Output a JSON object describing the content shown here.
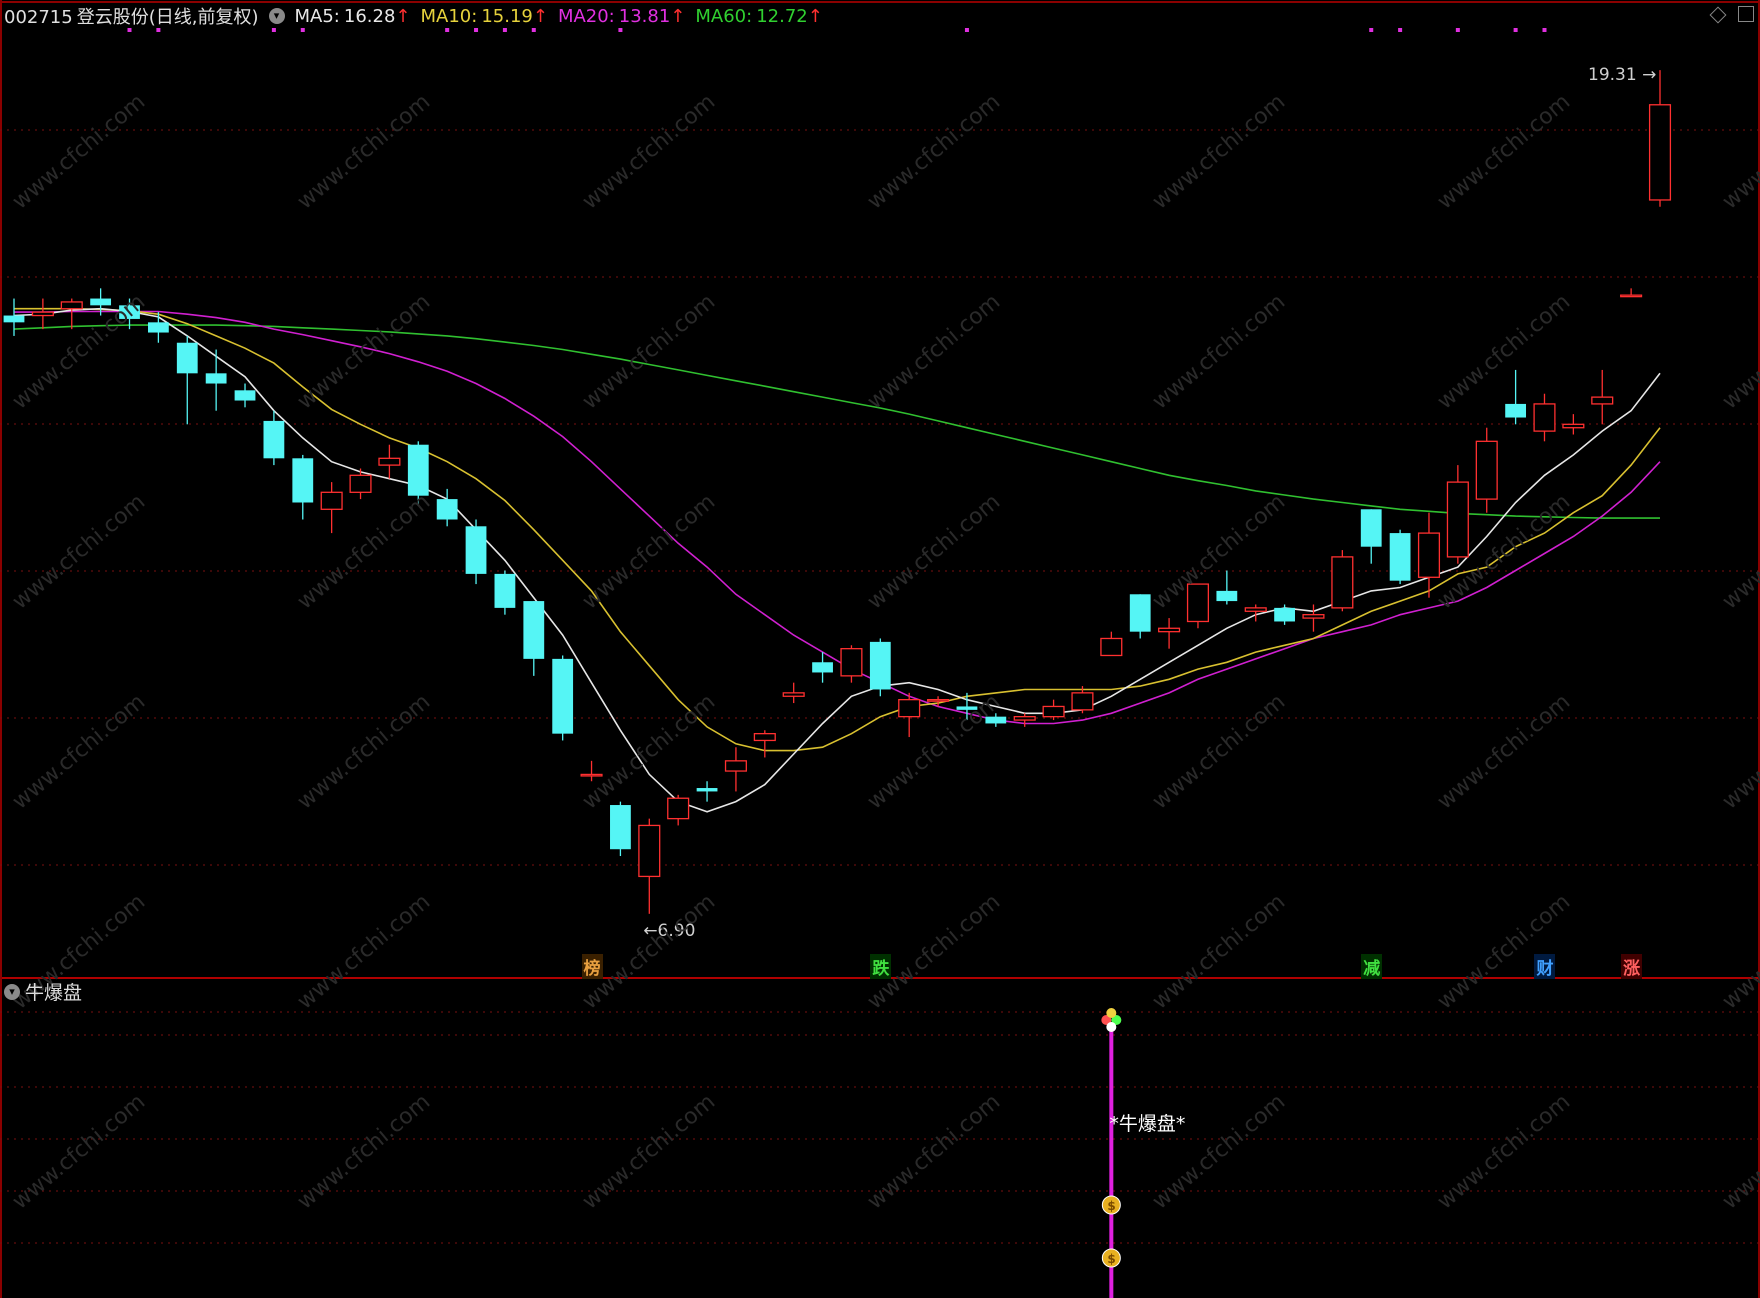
{
  "header": {
    "code": "002715",
    "name": "登云股份",
    "period": "(日线,前复权)",
    "ma5": {
      "label": "MA5:",
      "value": "16.28",
      "color": "#e8e8e8"
    },
    "ma10": {
      "label": "MA10:",
      "value": "15.19",
      "color": "#e6d23c"
    },
    "ma20": {
      "label": "MA20:",
      "value": "13.81",
      "color": "#e030e0"
    },
    "ma60": {
      "label": "MA60:",
      "value": "12.72",
      "color": "#30d030"
    },
    "arrow": "↑"
  },
  "annotations": {
    "high": "19.31",
    "low": "6.90",
    "high_arrow": "→",
    "low_arrow": "←"
  },
  "signals": [
    {
      "text": "榜",
      "color": "#e8a040",
      "bg": "#3a2000",
      "index": 20
    },
    {
      "text": "跌",
      "color": "#40e040",
      "bg": "#003000",
      "index": 30
    },
    {
      "text": "减",
      "color": "#40e040",
      "bg": "#003000",
      "index": 47
    },
    {
      "text": "财",
      "color": "#40a0ff",
      "bg": "#001a40",
      "index": 53
    },
    {
      "text": "涨",
      "color": "#ff6060",
      "bg": "#400000",
      "index": 56
    }
  ],
  "indicator": {
    "title": "牛爆盘",
    "label": "*牛爆盘*",
    "bar_index": 38
  },
  "chart_data": {
    "type": "candlestick",
    "ylim": [
      6.0,
      19.9
    ],
    "grid": "dotted-red",
    "ohlc": [
      [
        15.7,
        15.95,
        15.4,
        15.6
      ],
      [
        15.7,
        15.95,
        15.5,
        15.75
      ],
      [
        15.8,
        15.95,
        15.5,
        15.9
      ],
      [
        15.95,
        16.1,
        15.7,
        15.85
      ],
      [
        15.85,
        15.95,
        15.5,
        15.65
      ],
      [
        15.6,
        15.75,
        15.3,
        15.45
      ],
      [
        15.3,
        15.4,
        14.1,
        14.85
      ],
      [
        14.85,
        15.2,
        14.3,
        14.7
      ],
      [
        14.6,
        14.7,
        14.35,
        14.45
      ],
      [
        14.15,
        14.3,
        13.5,
        13.6
      ],
      [
        13.6,
        13.65,
        12.7,
        12.95
      ],
      [
        12.85,
        13.25,
        12.5,
        13.1
      ],
      [
        13.1,
        13.45,
        13.0,
        13.35
      ],
      [
        13.5,
        13.8,
        13.3,
        13.6
      ],
      [
        13.8,
        13.85,
        12.9,
        13.05
      ],
      [
        13.0,
        13.15,
        12.6,
        12.7
      ],
      [
        12.6,
        12.7,
        11.75,
        11.9
      ],
      [
        11.9,
        11.95,
        11.3,
        11.4
      ],
      [
        11.5,
        11.5,
        10.4,
        10.65
      ],
      [
        10.65,
        10.7,
        9.45,
        9.55
      ],
      [
        8.95,
        9.15,
        8.85,
        8.95
      ],
      [
        8.5,
        8.55,
        7.75,
        7.85
      ],
      [
        7.45,
        8.3,
        6.9,
        8.2
      ],
      [
        8.3,
        8.65,
        8.2,
        8.6
      ],
      [
        8.75,
        8.85,
        8.55,
        8.7
      ],
      [
        9.0,
        9.35,
        8.7,
        9.15
      ],
      [
        9.45,
        9.6,
        9.2,
        9.55
      ],
      [
        10.1,
        10.3,
        10.0,
        10.15
      ],
      [
        10.6,
        10.75,
        10.3,
        10.45
      ],
      [
        10.4,
        10.85,
        10.3,
        10.8
      ],
      [
        10.9,
        10.95,
        10.1,
        10.2
      ],
      [
        9.8,
        10.15,
        9.5,
        10.05
      ],
      [
        10.05,
        10.1,
        9.95,
        10.05
      ],
      [
        9.95,
        10.15,
        9.75,
        9.9
      ],
      [
        9.8,
        9.85,
        9.65,
        9.7
      ],
      [
        9.75,
        9.85,
        9.65,
        9.8
      ],
      [
        9.8,
        10.05,
        9.75,
        9.95
      ],
      [
        9.9,
        10.25,
        9.85,
        10.15
      ],
      [
        10.7,
        11.05,
        10.7,
        10.95
      ],
      [
        11.6,
        11.6,
        10.95,
        11.05
      ],
      [
        11.05,
        11.25,
        10.8,
        11.1
      ],
      [
        11.2,
        11.75,
        11.1,
        11.75
      ],
      [
        11.65,
        11.95,
        11.45,
        11.5
      ],
      [
        11.35,
        11.45,
        11.2,
        11.4
      ],
      [
        11.4,
        11.45,
        11.15,
        11.2
      ],
      [
        11.25,
        11.45,
        11.05,
        11.3
      ],
      [
        11.4,
        12.25,
        11.35,
        12.15
      ],
      [
        12.85,
        12.85,
        12.05,
        12.3
      ],
      [
        12.5,
        12.55,
        11.75,
        11.8
      ],
      [
        11.85,
        12.8,
        11.55,
        12.5
      ],
      [
        12.15,
        13.5,
        12.05,
        13.25
      ],
      [
        13.0,
        14.05,
        12.8,
        13.85
      ],
      [
        14.4,
        14.9,
        14.1,
        14.2
      ],
      [
        14.0,
        14.55,
        13.85,
        14.4
      ],
      [
        14.05,
        14.25,
        13.95,
        14.1
      ],
      [
        14.4,
        14.9,
        14.1,
        14.5
      ],
      [
        16.0,
        16.1,
        16.0,
        16.0
      ],
      [
        17.4,
        19.31,
        17.3,
        18.8
      ]
    ],
    "ma5": [
      15.7,
      15.72,
      15.78,
      15.8,
      15.76,
      15.68,
      15.4,
      15.1,
      14.8,
      14.3,
      13.9,
      13.55,
      13.4,
      13.3,
      13.2,
      13.0,
      12.55,
      12.1,
      11.55,
      11.0,
      10.3,
      9.6,
      8.95,
      8.55,
      8.4,
      8.55,
      8.8,
      9.25,
      9.7,
      10.1,
      10.25,
      10.3,
      10.2,
      10.05,
      9.95,
      9.85,
      9.85,
      9.9,
      10.1,
      10.35,
      10.6,
      10.85,
      11.1,
      11.3,
      11.4,
      11.35,
      11.5,
      11.65,
      11.7,
      11.85,
      12.0,
      12.45,
      12.95,
      13.35,
      13.65,
      14.0,
      14.3,
      14.85
    ],
    "ma10": [
      15.8,
      15.8,
      15.8,
      15.79,
      15.77,
      15.72,
      15.58,
      15.4,
      15.22,
      15.0,
      14.65,
      14.32,
      14.1,
      13.9,
      13.75,
      13.55,
      13.3,
      12.98,
      12.55,
      12.1,
      11.65,
      11.05,
      10.55,
      10.05,
      9.65,
      9.4,
      9.3,
      9.3,
      9.35,
      9.55,
      9.8,
      9.95,
      10.0,
      10.1,
      10.15,
      10.2,
      10.2,
      10.2,
      10.2,
      10.25,
      10.35,
      10.5,
      10.6,
      10.75,
      10.85,
      10.95,
      11.15,
      11.35,
      11.5,
      11.65,
      11.9,
      12.0,
      12.3,
      12.5,
      12.8,
      13.05,
      13.5,
      14.05
    ],
    "ma20": [
      15.75,
      15.75,
      15.76,
      15.76,
      15.76,
      15.76,
      15.72,
      15.67,
      15.6,
      15.5,
      15.42,
      15.33,
      15.24,
      15.14,
      15.02,
      14.88,
      14.7,
      14.48,
      14.22,
      13.92,
      13.55,
      13.15,
      12.75,
      12.35,
      12.0,
      11.6,
      11.3,
      11.0,
      10.75,
      10.5,
      10.3,
      10.1,
      9.95,
      9.85,
      9.75,
      9.7,
      9.7,
      9.75,
      9.85,
      10.0,
      10.15,
      10.35,
      10.5,
      10.65,
      10.8,
      10.95,
      11.05,
      11.15,
      11.3,
      11.4,
      11.5,
      11.7,
      11.95,
      12.2,
      12.45,
      12.75,
      13.1,
      13.55
    ],
    "ma60": [
      15.5,
      15.52,
      15.54,
      15.55,
      15.56,
      15.56,
      15.56,
      15.56,
      15.55,
      15.54,
      15.52,
      15.5,
      15.48,
      15.46,
      15.43,
      15.4,
      15.36,
      15.31,
      15.26,
      15.2,
      15.13,
      15.06,
      14.98,
      14.9,
      14.82,
      14.74,
      14.66,
      14.58,
      14.5,
      14.42,
      14.34,
      14.25,
      14.15,
      14.05,
      13.95,
      13.85,
      13.75,
      13.65,
      13.55,
      13.45,
      13.35,
      13.27,
      13.2,
      13.12,
      13.06,
      13.0,
      12.95,
      12.9,
      12.85,
      12.82,
      12.79,
      12.77,
      12.75,
      12.74,
      12.73,
      12.72,
      12.72,
      12.72
    ]
  }
}
